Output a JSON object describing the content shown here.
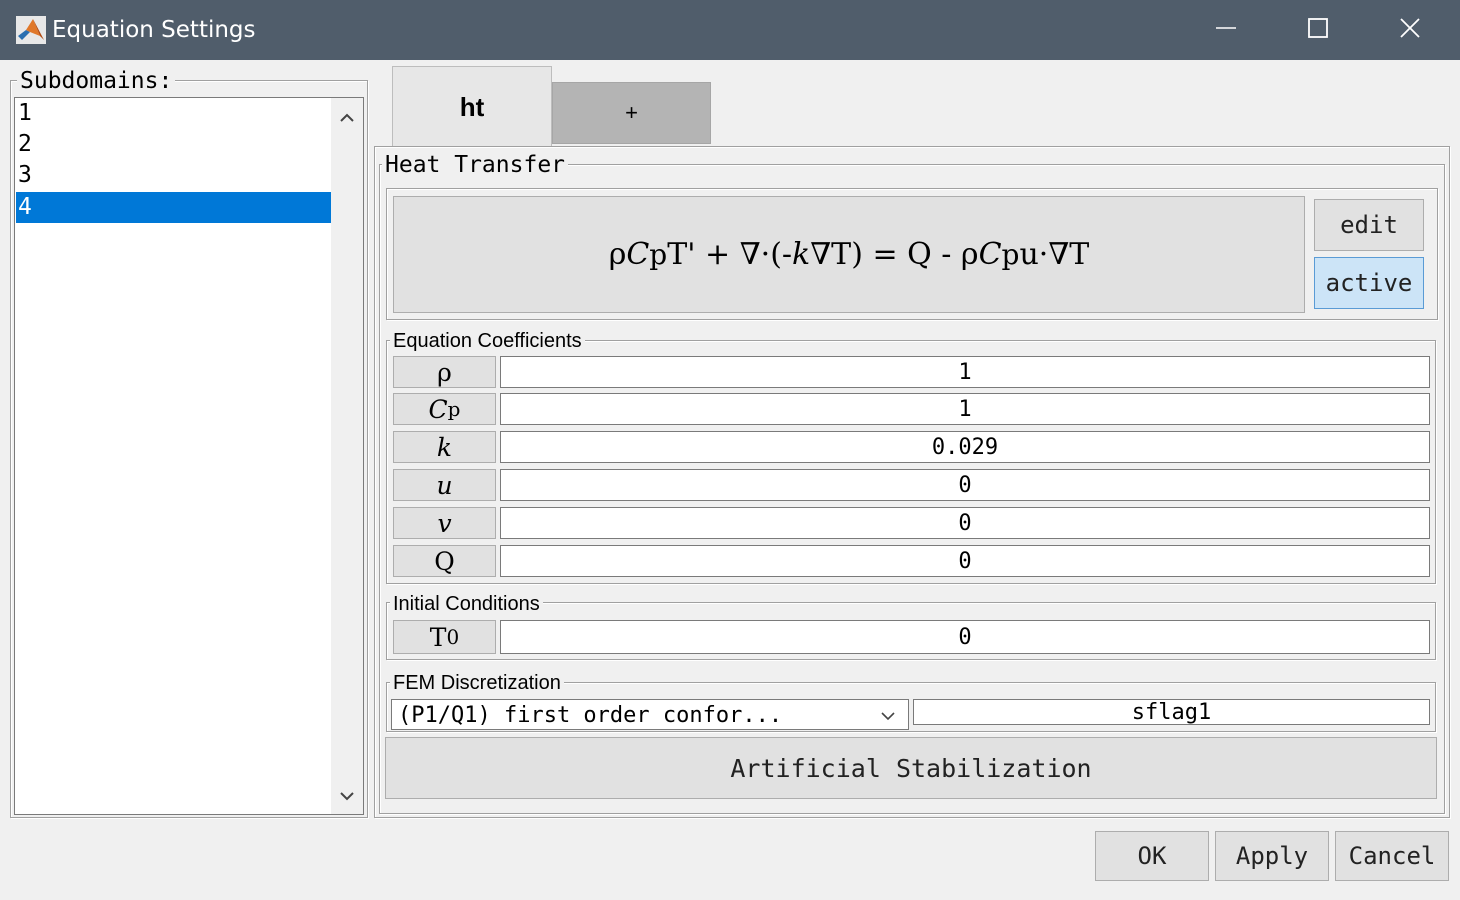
{
  "window": {
    "title": "Equation Settings",
    "controls": {
      "minimize": "minimize-icon",
      "maximize": "maximize-icon",
      "close": "close-icon"
    }
  },
  "subdomains": {
    "label": "Subdomains:",
    "items": [
      "1",
      "2",
      "3",
      "4"
    ],
    "selected": "4"
  },
  "tabs": [
    {
      "label": "ht",
      "active": true
    },
    {
      "label": "+",
      "active": false
    }
  ],
  "heat_transfer": {
    "title": "Heat Transfer",
    "equation": {
      "rho": "ρ",
      "C": "C",
      "p": "p",
      "T_prime": "T'",
      "plus_div": " + ∇·(-",
      "k": "k",
      "grad_T": "∇T",
      "close_eq": ") = Q - ρ",
      "C2": "C",
      "p2": "p",
      "u_dot": "u·",
      "grad_T2": "∇T"
    },
    "edit_label": "edit",
    "active_label": "active"
  },
  "coefficients": {
    "title": "Equation Coefficients",
    "rows": [
      {
        "symbol": "ρ",
        "sub": "",
        "value": "1"
      },
      {
        "symbol": "C",
        "sub": "p",
        "value": "1"
      },
      {
        "symbol": "k",
        "sub": "",
        "value": "0.029"
      },
      {
        "symbol": "u",
        "sub": "",
        "value": "0"
      },
      {
        "symbol": "v",
        "sub": "",
        "value": "0"
      },
      {
        "symbol": "Q",
        "sub": "",
        "value": "0"
      }
    ]
  },
  "initial_conditions": {
    "title": "Initial Conditions",
    "symbol": "T",
    "sub": "0",
    "value": "0"
  },
  "fem": {
    "title": "FEM Discretization",
    "selected": "(P1/Q1) first order confor...",
    "sflag": "sflag1",
    "stabilization_label": "Artificial Stabilization"
  },
  "footer": {
    "ok": "OK",
    "apply": "Apply",
    "cancel": "Cancel"
  },
  "colors": {
    "titlebar": "#505d6b",
    "selection": "#0078d7",
    "active_button": "#cce4f7"
  }
}
